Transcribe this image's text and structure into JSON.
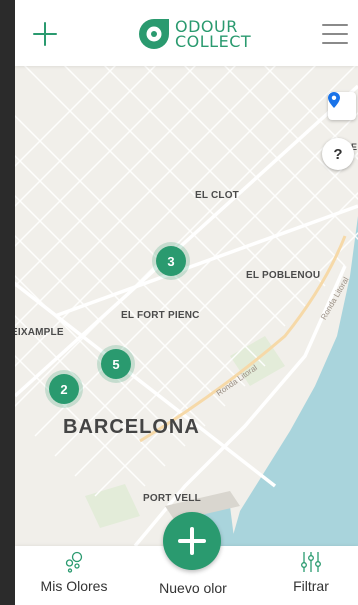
{
  "header": {
    "logo_line1": "ODOUR",
    "logo_line2": "COLLECT"
  },
  "map": {
    "labels": {
      "el_clot": "EL CLOT",
      "el_poblenou": "EL POBLENOU",
      "el_fort_pienc": "EL FORT PIENC",
      "eixample": "EIXAMPLE",
      "barcelona": "BARCELONA",
      "port_vell": "PORT VELL",
      "ronda_litoral_1": "Ronda Litoral",
      "ronda_litoral_2": "Ronda Litoral",
      "edge_letter": "E"
    },
    "clusters": {
      "c1": "3",
      "c2": "5",
      "c3": "2"
    },
    "help_label": "?"
  },
  "bottombar": {
    "mis_olores": "Mis Olores",
    "nuevo_olor": "Nuevo olor",
    "filtrar": "Filtrar"
  },
  "colors": {
    "accent": "#2a9a6f",
    "sea": "#a9d4dc",
    "location_pin": "#1a73e8"
  }
}
